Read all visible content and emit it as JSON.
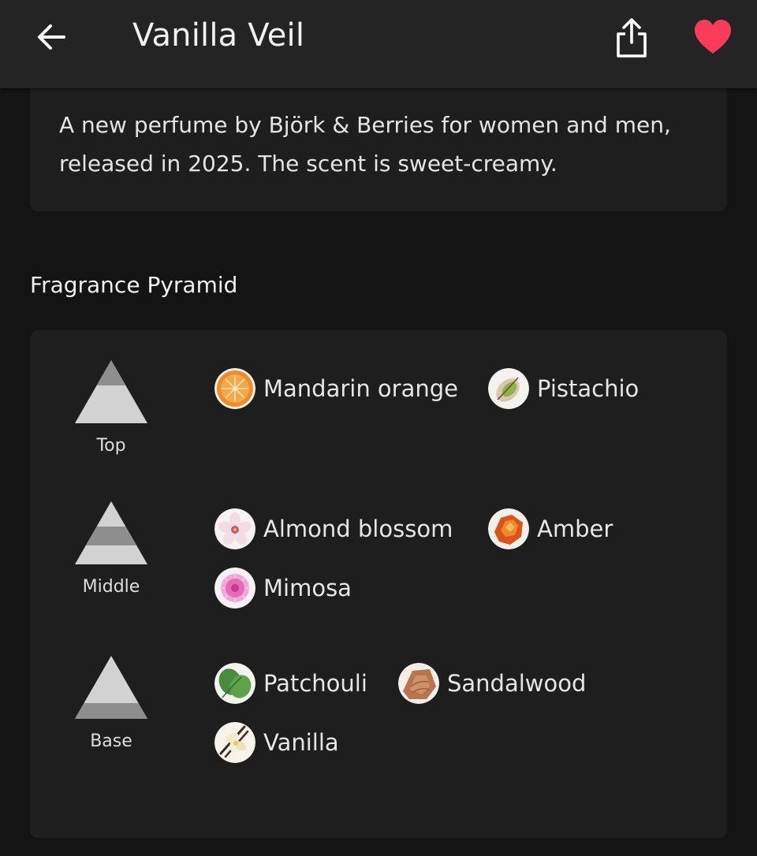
{
  "header": {
    "title": "Vanilla Veil",
    "icons": {
      "back": "arrow-left-icon",
      "share": "share-icon",
      "favorite": "heart-icon"
    },
    "favorite_color": "#fb3b5a"
  },
  "description": "A new perfume by Björk & Berries for women and men, released in 2025. The scent is sweet-creamy.",
  "pyramid": {
    "title": "Fragrance Pyramid",
    "tiers": [
      {
        "label": "Top",
        "notes": [
          {
            "name": "Mandarin orange",
            "icon": "mandarin-orange-icon"
          },
          {
            "name": "Pistachio",
            "icon": "pistachio-icon"
          }
        ]
      },
      {
        "label": "Middle",
        "notes": [
          {
            "name": "Almond blossom",
            "icon": "almond-blossom-icon"
          },
          {
            "name": "Amber",
            "icon": "amber-icon"
          },
          {
            "name": "Mimosa",
            "icon": "mimosa-icon"
          }
        ]
      },
      {
        "label": "Base",
        "notes": [
          {
            "name": "Patchouli",
            "icon": "patchouli-icon"
          },
          {
            "name": "Sandalwood",
            "icon": "sandalwood-icon"
          },
          {
            "name": "Vanilla",
            "icon": "vanilla-icon"
          }
        ]
      }
    ]
  }
}
